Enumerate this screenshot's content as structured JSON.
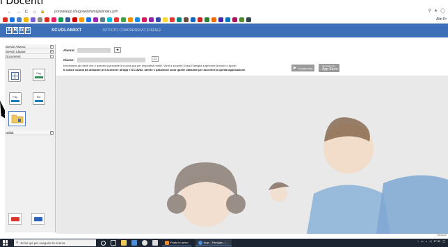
{
  "caption": "i Docenti",
  "browser": {
    "url": "portaleargo.it/argoweb/famiglia/index.jsf#",
    "other_bookmarks": "Altri Pr"
  },
  "header": {
    "logo_letters": [
      "A",
      "R",
      "G",
      "O"
    ],
    "product": "SCUOLANEXT",
    "school": "ISTITUTO COMPRENSIVO STATALE"
  },
  "sidebar": {
    "items_top": [
      {
        "label": "Servizi Alunno",
        "toggle": "+"
      },
      {
        "label": "Servizi Classe",
        "toggle": "+"
      },
      {
        "label": "Documenti",
        "toggle": "-"
      }
    ],
    "doc_buttons": [
      {
        "label": ""
      },
      {
        "label": "Pag."
      },
      {
        "label": "Pag."
      },
      {
        "label": "Bol."
      }
    ],
    "utility": {
      "label": "Utilità",
      "toggle": "+"
    }
  },
  "main": {
    "alunno_label": "Alunno:",
    "classe_label": "Classe:",
    "info_line1": "Informiamo gli utenti che è adesso scaricabile la nuova app per dispositivi mobili. Vieni a scoprire Didup Famiglia sugli store Android e Apple!",
    "info_line2": "Il codice scuola da utilizzare per accedere all'app è SC18282, utente e password sono quelle utilizzate per accedere a questa applicazione.",
    "google_play": "Google play",
    "app_store": "App Store",
    "app_store_small": "Download on the"
  },
  "taskbar": {
    "search_placeholder": "Scrivi qui per eseguire la ricerca",
    "apps": [
      "Posta in arrivo",
      "Argo - Famiglia - L..."
    ],
    "time": "17:32"
  },
  "versione": "Versione"
}
